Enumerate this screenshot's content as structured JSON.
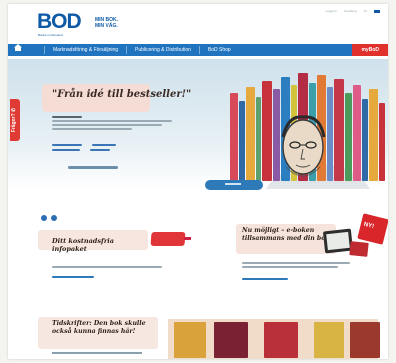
{
  "brand": {
    "logo": "BOD",
    "logo_sub": "Books on Demand",
    "tagline": [
      "MIN BOK.",
      "MIN VÄG."
    ]
  },
  "header": {
    "util_links": [
      "Logga in",
      "Kundkorg",
      "Sv"
    ]
  },
  "nav": {
    "items": [
      "Marknadsföring & Försäljning",
      "Publicering & Distribution",
      "BoD Shop"
    ],
    "cta": "myBoD"
  },
  "hero": {
    "headline": "\"Från idé till bestseller!\"",
    "side_tab": "Frågor? ✆"
  },
  "promo_left": {
    "title": "Ditt kostnadsfria infopaket"
  },
  "promo_right": {
    "title": "Nu möjligt – e-boken tillsammans med din bok!",
    "badge": "NY!"
  },
  "bottom": {
    "title": "Tidskrifter: Den bok skulle också kunna finnas här!"
  },
  "colors": {
    "brand_blue": "#0f5aa6",
    "nav_blue": "#1f73bf",
    "accent_red": "#e1312d"
  }
}
